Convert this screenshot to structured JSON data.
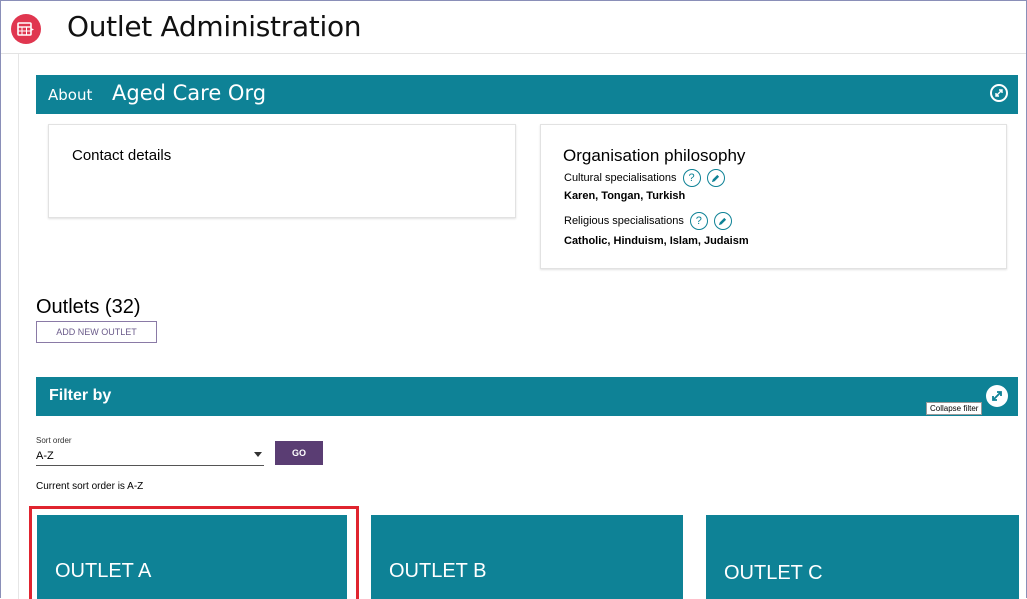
{
  "header": {
    "title": "Outlet Administration",
    "icon": "calendar-grid-icon"
  },
  "about": {
    "label": "About",
    "org_name": "Aged Care Org"
  },
  "contact": {
    "title": "Contact details"
  },
  "philosophy": {
    "title": "Organisation philosophy",
    "cultural_label": "Cultural specialisations",
    "cultural_values": "Karen, Tongan, Turkish",
    "religious_label": "Religious specialisations",
    "religious_values": "Catholic, Hinduism, Islam, Judaism",
    "help_glyph": "?"
  },
  "outlets": {
    "title": "Outlets (32)",
    "add_button": "ADD NEW OUTLET"
  },
  "filter": {
    "label": "Filter by",
    "tooltip": "Collapse filter",
    "sort_label": "Sort order",
    "sort_value": "A-Z",
    "go_button": "GO",
    "status": "Current sort order is A-Z"
  },
  "tiles": [
    {
      "name": "OUTLET A"
    },
    {
      "name": "OUTLET B"
    },
    {
      "name": "OUTLET C"
    }
  ],
  "colors": {
    "teal": "#0e8296",
    "purple": "#5a3d73",
    "red_icon": "#e0364f",
    "highlight": "#e0242f"
  }
}
